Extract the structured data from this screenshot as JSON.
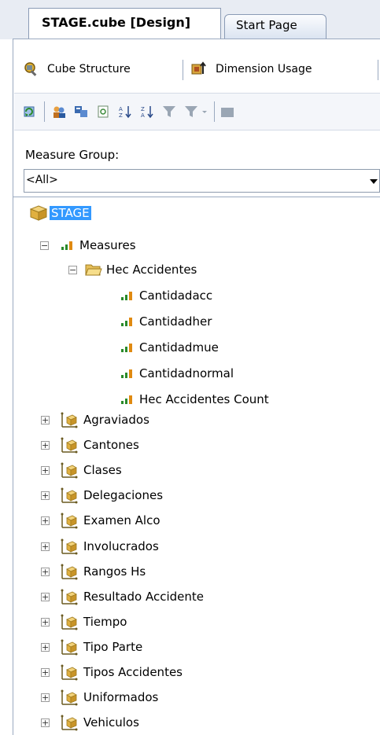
{
  "tabs": {
    "active": "STAGE.cube [Design]",
    "inactive": "Start Page"
  },
  "designer_tabs": [
    {
      "label": "Cube Structure",
      "icon": "cube-structure-icon"
    },
    {
      "label": "Dimension Usage",
      "icon": "dimension-usage-icon"
    }
  ],
  "toolbar_icons": [
    "refresh-icon",
    "users-icon",
    "calculation-icon",
    "properties-icon",
    "sort-ascending-icon",
    "sort-descending-icon",
    "filter-icon",
    "filter-dropdown-icon",
    "dropdown-arrow-icon",
    "folder-icon"
  ],
  "measure_group": {
    "label": "Measure Group:",
    "value": "<All>"
  },
  "tree": {
    "root": "STAGE",
    "measures": "Measures",
    "measure_group": "Hec Accidentes",
    "measure_items": [
      "Cantidadacc",
      "Cantidadher",
      "Cantidadmue",
      "Cantidadnormal",
      "Hec Accidentes Count"
    ],
    "dimensions": [
      "Agraviados",
      "Cantones",
      "Clases",
      "Delegaciones",
      "Examen Alco",
      "Involucrados",
      "Rangos Hs",
      "Resultado Accidente",
      "Tiempo",
      "Tipo Parte",
      "Tipos Accidentes",
      "Uniformados",
      "Vehiculos"
    ]
  }
}
